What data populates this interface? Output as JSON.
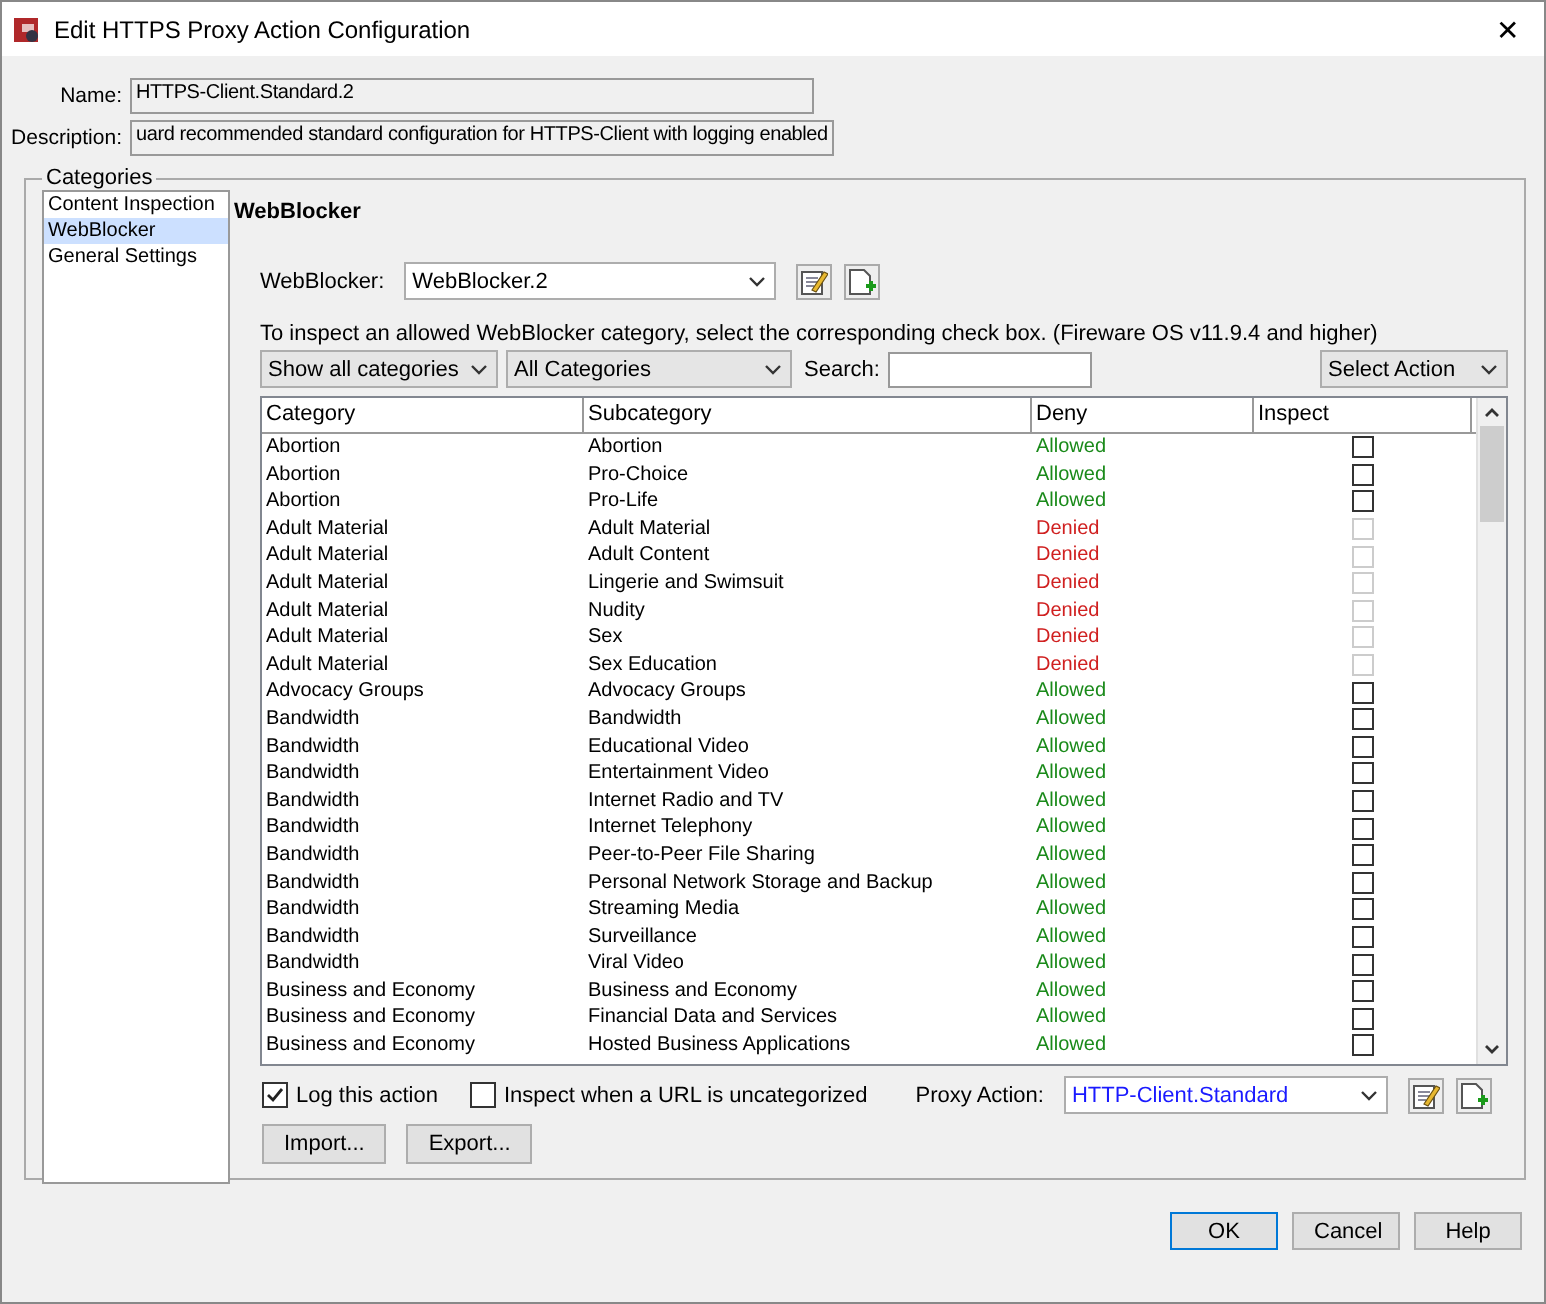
{
  "window": {
    "title": "Edit HTTPS Proxy Action Configuration",
    "close": "✕"
  },
  "name": {
    "label": "Name:",
    "value": "HTTPS-Client.Standard.2"
  },
  "description": {
    "label": "Description:",
    "value": "uard recommended standard configuration for HTTPS-Client with logging enabled"
  },
  "categories": {
    "title": "Categories",
    "items": [
      {
        "label": "Content Inspection",
        "selected": false
      },
      {
        "label": "WebBlocker",
        "selected": true
      },
      {
        "label": "General Settings",
        "selected": false
      }
    ]
  },
  "panel": {
    "heading": "WebBlocker",
    "webblocker_label": "WebBlocker:",
    "webblocker_value": "WebBlocker.2",
    "hint": "To inspect an allowed WebBlocker category, select the corresponding check box. (Fireware OS v11.9.4 and higher)",
    "filter_show": "Show all categories",
    "filter_category": "All Categories",
    "search_label": "Search:",
    "select_action": "Select Action"
  },
  "table": {
    "columns": [
      "Category",
      "Subcategory",
      "Deny",
      "Inspect"
    ],
    "rows": [
      {
        "category": "Abortion",
        "subcategory": "Abortion",
        "deny": "Allowed",
        "denied": false,
        "checked": false,
        "disabled": false
      },
      {
        "category": "Abortion",
        "subcategory": "Pro-Choice",
        "deny": "Allowed",
        "denied": false,
        "checked": false,
        "disabled": false
      },
      {
        "category": "Abortion",
        "subcategory": "Pro-Life",
        "deny": "Allowed",
        "denied": false,
        "checked": false,
        "disabled": false
      },
      {
        "category": "Adult Material",
        "subcategory": "Adult Material",
        "deny": "Denied",
        "denied": true,
        "checked": false,
        "disabled": true
      },
      {
        "category": "Adult Material",
        "subcategory": "Adult Content",
        "deny": "Denied",
        "denied": true,
        "checked": false,
        "disabled": true
      },
      {
        "category": "Adult Material",
        "subcategory": "Lingerie and Swimsuit",
        "deny": "Denied",
        "denied": true,
        "checked": false,
        "disabled": true
      },
      {
        "category": "Adult Material",
        "subcategory": "Nudity",
        "deny": "Denied",
        "denied": true,
        "checked": false,
        "disabled": true
      },
      {
        "category": "Adult Material",
        "subcategory": "Sex",
        "deny": "Denied",
        "denied": true,
        "checked": false,
        "disabled": true
      },
      {
        "category": "Adult Material",
        "subcategory": "Sex Education",
        "deny": "Denied",
        "denied": true,
        "checked": false,
        "disabled": true
      },
      {
        "category": "Advocacy Groups",
        "subcategory": "Advocacy Groups",
        "deny": "Allowed",
        "denied": false,
        "checked": false,
        "disabled": false
      },
      {
        "category": "Bandwidth",
        "subcategory": "Bandwidth",
        "deny": "Allowed",
        "denied": false,
        "checked": false,
        "disabled": false
      },
      {
        "category": "Bandwidth",
        "subcategory": "Educational Video",
        "deny": "Allowed",
        "denied": false,
        "checked": false,
        "disabled": false
      },
      {
        "category": "Bandwidth",
        "subcategory": "Entertainment Video",
        "deny": "Allowed",
        "denied": false,
        "checked": false,
        "disabled": false
      },
      {
        "category": "Bandwidth",
        "subcategory": "Internet Radio and TV",
        "deny": "Allowed",
        "denied": false,
        "checked": false,
        "disabled": false
      },
      {
        "category": "Bandwidth",
        "subcategory": "Internet Telephony",
        "deny": "Allowed",
        "denied": false,
        "checked": false,
        "disabled": false
      },
      {
        "category": "Bandwidth",
        "subcategory": "Peer-to-Peer File Sharing",
        "deny": "Allowed",
        "denied": false,
        "checked": false,
        "disabled": false
      },
      {
        "category": "Bandwidth",
        "subcategory": "Personal Network Storage and Backup",
        "deny": "Allowed",
        "denied": false,
        "checked": false,
        "disabled": false
      },
      {
        "category": "Bandwidth",
        "subcategory": "Streaming Media",
        "deny": "Allowed",
        "denied": false,
        "checked": false,
        "disabled": false
      },
      {
        "category": "Bandwidth",
        "subcategory": "Surveillance",
        "deny": "Allowed",
        "denied": false,
        "checked": false,
        "disabled": false
      },
      {
        "category": "Bandwidth",
        "subcategory": "Viral Video",
        "deny": "Allowed",
        "denied": false,
        "checked": false,
        "disabled": false
      },
      {
        "category": "Business and Economy",
        "subcategory": "Business and Economy",
        "deny": "Allowed",
        "denied": false,
        "checked": false,
        "disabled": false
      },
      {
        "category": "Business and Economy",
        "subcategory": "Financial Data and Services",
        "deny": "Allowed",
        "denied": false,
        "checked": false,
        "disabled": false
      },
      {
        "category": "Business and Economy",
        "subcategory": "Hosted Business Applications",
        "deny": "Allowed",
        "denied": false,
        "checked": false,
        "disabled": false
      }
    ]
  },
  "options": [
    {
      "label": "Log this action",
      "checked": true
    },
    {
      "label": "Inspect when a URL is uncategorized",
      "checked": false
    }
  ],
  "proxy_action": {
    "label": "Proxy Action:",
    "value": "HTTP-Client.Standard"
  },
  "actions": [
    "Import...",
    "Export..."
  ],
  "footer_buttons": [
    {
      "label": "OK",
      "default": true
    },
    {
      "label": "Cancel",
      "default": false
    },
    {
      "label": "Help",
      "default": false
    }
  ]
}
